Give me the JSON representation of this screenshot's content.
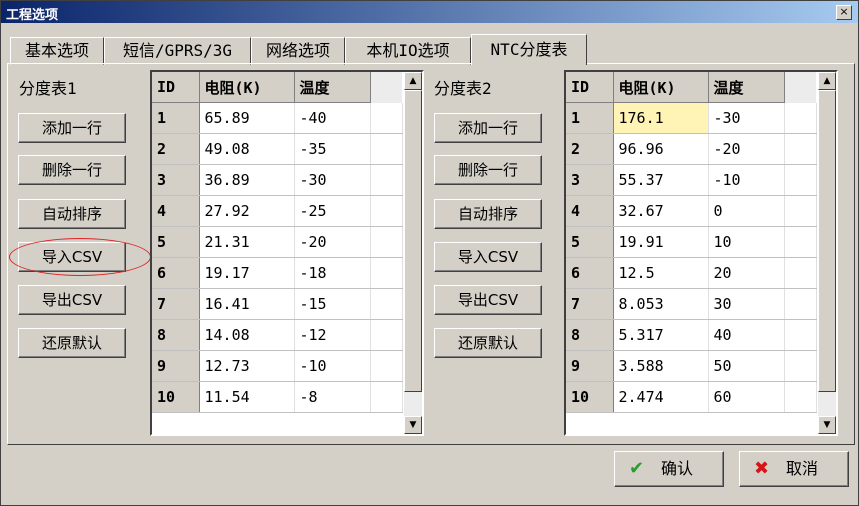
{
  "window": {
    "title": "工程选项",
    "close_glyph": "×"
  },
  "tabs": [
    "基本选项",
    "短信/GPRS/3G",
    "网络选项",
    "本机IO选项",
    "NTC分度表"
  ],
  "active_tab": 4,
  "table1": {
    "label": "分度表1",
    "buttons": [
      "添加一行",
      "删除一行",
      "自动排序",
      "导入CSV",
      "导出CSV",
      "还原默认"
    ],
    "highlighted_button": "导入CSV",
    "columns": [
      "ID",
      "电阻(K)",
      "温度"
    ],
    "rows": [
      [
        "1",
        "65.89",
        "-40"
      ],
      [
        "2",
        "49.08",
        "-35"
      ],
      [
        "3",
        "36.89",
        "-30"
      ],
      [
        "4",
        "27.92",
        "-25"
      ],
      [
        "5",
        "21.31",
        "-20"
      ],
      [
        "6",
        "19.17",
        "-18"
      ],
      [
        "7",
        "16.41",
        "-15"
      ],
      [
        "8",
        "14.08",
        "-12"
      ],
      [
        "9",
        "12.73",
        "-10"
      ],
      [
        "10",
        "11.54",
        "-8"
      ]
    ]
  },
  "table2": {
    "label": "分度表2",
    "buttons": [
      "添加一行",
      "删除一行",
      "自动排序",
      "导入CSV",
      "导出CSV",
      "还原默认"
    ],
    "columns": [
      "ID",
      "电阻(K)",
      "温度"
    ],
    "rows": [
      [
        "1",
        "176.1",
        "-30"
      ],
      [
        "2",
        "96.96",
        "-20"
      ],
      [
        "3",
        "55.37",
        "-10"
      ],
      [
        "4",
        "32.67",
        "0"
      ],
      [
        "5",
        "19.91",
        "10"
      ],
      [
        "6",
        "12.5",
        "20"
      ],
      [
        "7",
        "8.053",
        "30"
      ],
      [
        "8",
        "5.317",
        "40"
      ],
      [
        "9",
        "3.588",
        "50"
      ],
      [
        "10",
        "2.474",
        "60"
      ]
    ],
    "selected_cell": "176.1"
  },
  "footer": {
    "ok_label": "确认",
    "ok_icon": "check-icon",
    "cancel_label": "取消",
    "cancel_icon": "x-icon"
  },
  "colors": {
    "selected_cell": "#fff3b5",
    "highlight_oval": "#d22",
    "ok_icon": "#2a9d2a",
    "cancel_icon": "#d01818"
  }
}
